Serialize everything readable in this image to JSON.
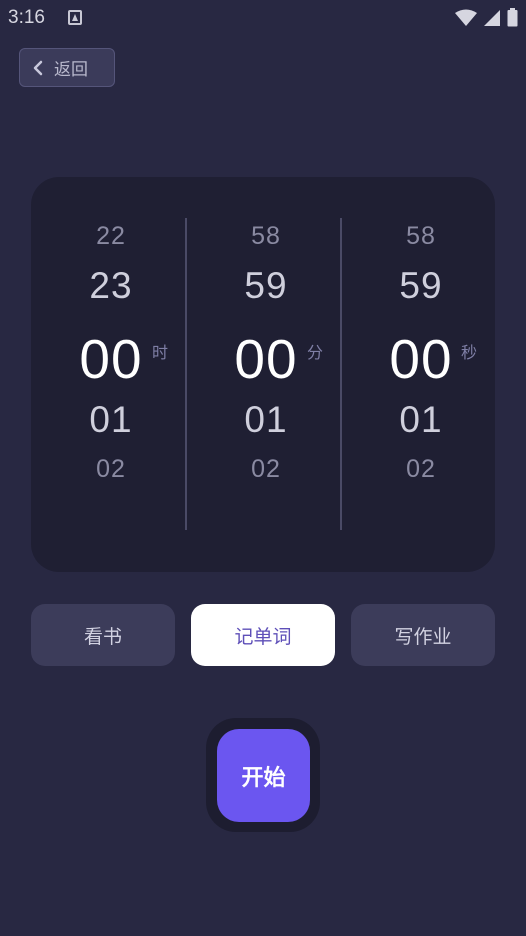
{
  "status_bar": {
    "time": "3:16"
  },
  "header": {
    "back_label": "返回"
  },
  "picker": {
    "hours": {
      "far_above": "22",
      "above": "23",
      "selected": "00",
      "below": "01",
      "far_below": "02",
      "unit": "时"
    },
    "minutes": {
      "far_above": "58",
      "above": "59",
      "selected": "00",
      "below": "01",
      "far_below": "02",
      "unit": "分"
    },
    "seconds": {
      "far_above": "58",
      "above": "59",
      "selected": "00",
      "below": "01",
      "far_below": "02",
      "unit": "秒"
    }
  },
  "tasks": [
    {
      "label": "看书",
      "active": false
    },
    {
      "label": "记单词",
      "active": true
    },
    {
      "label": "写作业",
      "active": false
    }
  ],
  "start": {
    "label": "开始"
  },
  "colors": {
    "background": "#282842",
    "panel": "#1f1f33",
    "accent": "#6b56f0",
    "chip": "#3c3c5a"
  }
}
